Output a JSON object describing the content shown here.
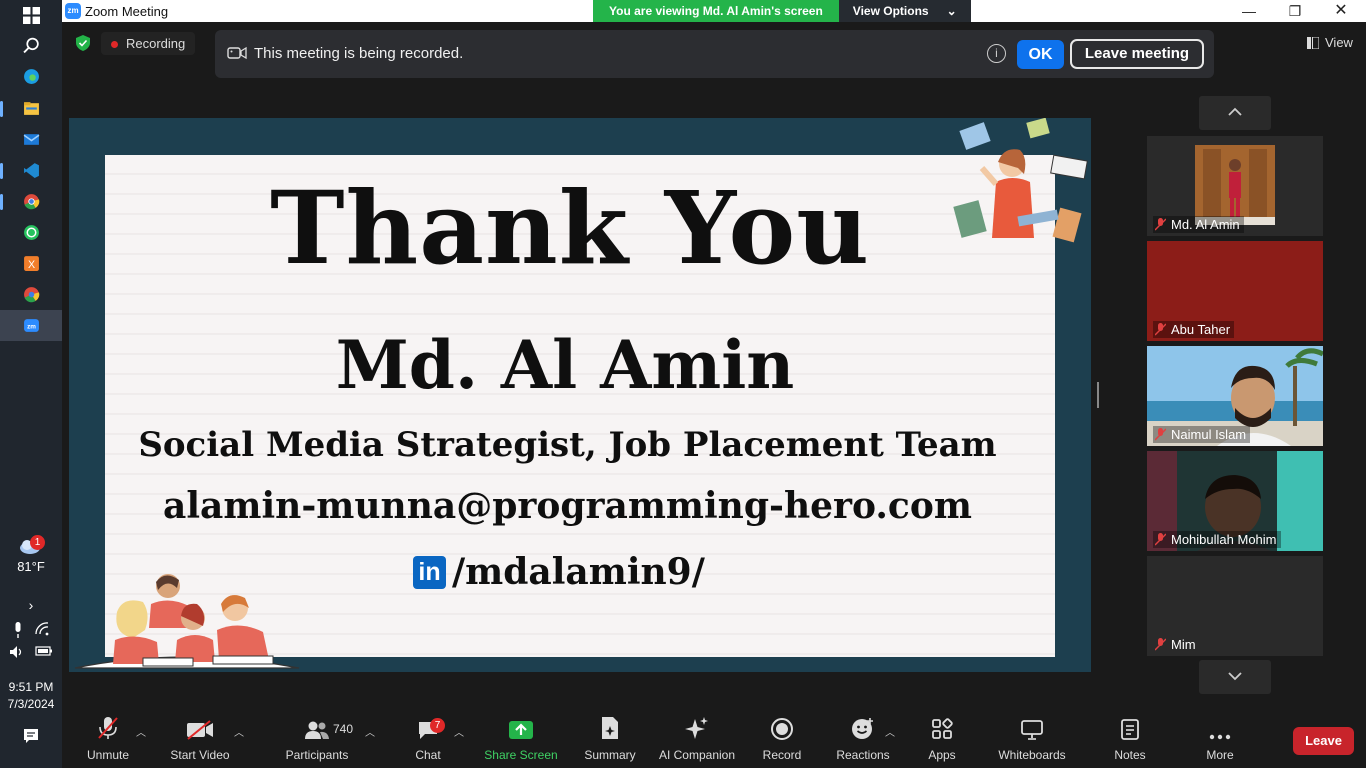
{
  "window": {
    "title": "Zoom Meeting"
  },
  "viewing_banner": {
    "text": "You are viewing Md. Al Amin's screen",
    "options_label": "View Options"
  },
  "recording": {
    "label": "Recording"
  },
  "notice": {
    "message": "This meeting is being recorded.",
    "ok_label": "OK",
    "leave_label": "Leave meeting"
  },
  "view_label": "View",
  "slide": {
    "title": "Thank You",
    "name": "Md. Al Amin",
    "role": "Social Media Strategist, Job Placement Team",
    "email": "alamin-munna@programming-hero.com",
    "linkedin_logo": "in",
    "linkedin": "/mdalamin9/"
  },
  "gallery": {
    "participants": [
      {
        "name": "Md. Al Amin",
        "muted": true
      },
      {
        "name": "Abu Taher",
        "muted": true
      },
      {
        "name": "Naimul Islam",
        "muted": true
      },
      {
        "name": "Mohibullah Mohim",
        "muted": true
      },
      {
        "name": "Mim",
        "muted": true
      }
    ]
  },
  "toolbar": {
    "unmute": "Unmute",
    "start_video": "Start Video",
    "participants": "Participants",
    "participants_count": "740",
    "chat": "Chat",
    "chat_badge": "7",
    "share_screen": "Share Screen",
    "summary": "Summary",
    "ai_companion": "AI Companion",
    "record": "Record",
    "reactions": "Reactions",
    "apps": "Apps",
    "whiteboards": "Whiteboards",
    "notes": "Notes",
    "more": "More",
    "leave": "Leave"
  },
  "system": {
    "weather_badge": "1",
    "temperature": "81°F",
    "time": "9:51 PM",
    "date": "7/3/2024"
  },
  "colors": {
    "accent": "#0e72ed",
    "share": "#24b44a",
    "leave": "#c8242b",
    "slide_bg": "#1d3f4f"
  }
}
